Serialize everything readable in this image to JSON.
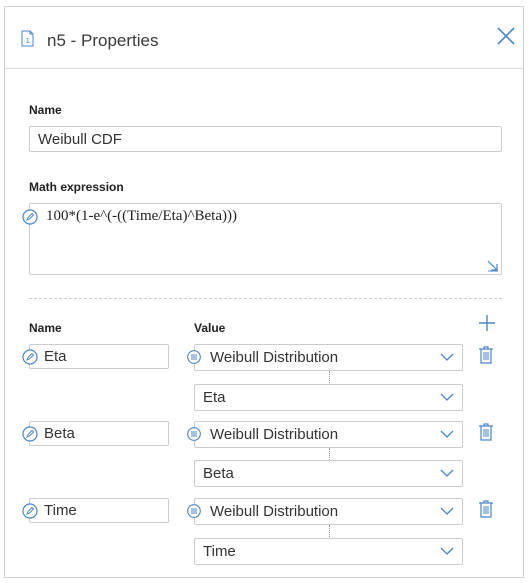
{
  "header": {
    "title": "n5 - Properties",
    "icon": "document-icon",
    "close_icon": "close-icon"
  },
  "name_field": {
    "label": "Name",
    "value": "Weibull CDF"
  },
  "math_expression": {
    "label": "Math expression",
    "value": "100*(1-e^(-((Time/Eta)^Beta)))"
  },
  "params": {
    "name_header": "Name",
    "value_header": "Value",
    "rows": [
      {
        "name": "Eta",
        "source": "Weibull Distribution",
        "field": "Eta"
      },
      {
        "name": "Beta",
        "source": "Weibull Distribution",
        "field": "Beta"
      },
      {
        "name": "Time",
        "source": "Weibull Distribution",
        "field": "Time"
      }
    ]
  },
  "colors": {
    "accent": "#4a86c8",
    "border": "#cccccc"
  }
}
